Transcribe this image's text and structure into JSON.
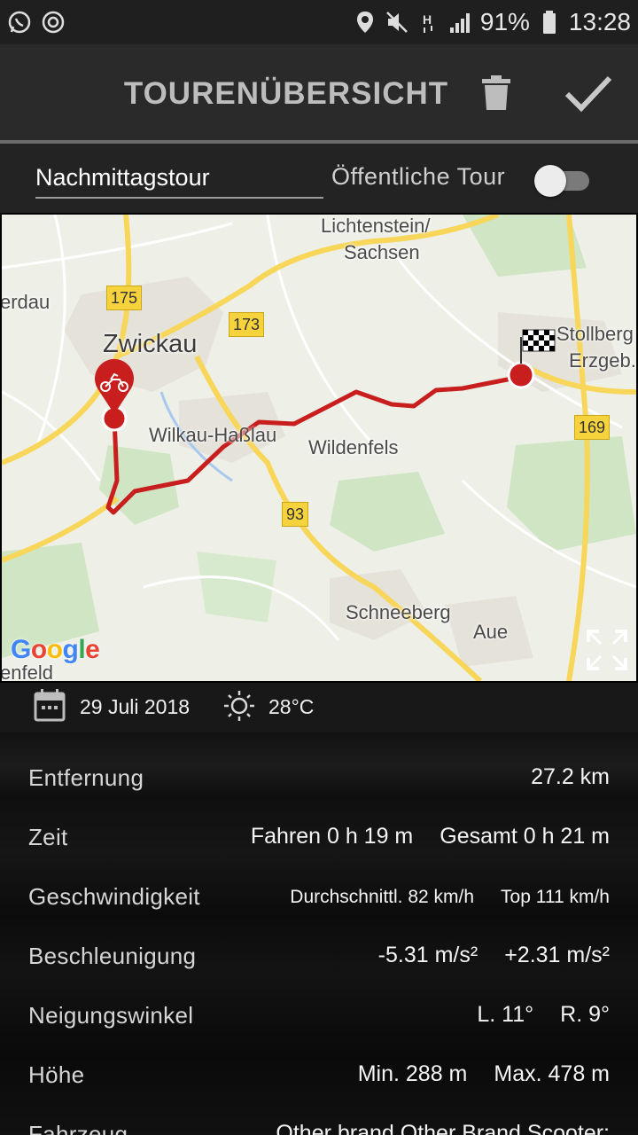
{
  "status_bar": {
    "battery": "91%",
    "time": "13:28"
  },
  "header": {
    "title": "TOURENÜBERSICHT"
  },
  "tour": {
    "name": "Nachmittagstour",
    "public_label": "Öffentliche Tour",
    "public_enabled": false
  },
  "map": {
    "labels": {
      "lichtenstein": "Lichtenstein/",
      "sachsen": "Sachsen",
      "erdau": "erdau",
      "zwickau": "Zwickau",
      "stollberg": "Stollberg",
      "erzgeb": "Erzgeb.",
      "wilkau": "Wilkau-Haßlau",
      "wildenfels": "Wildenfels",
      "schneeberg": "Schneeberg",
      "aue": "Aue",
      "enfeld": "enfeld"
    },
    "roads": {
      "r175": "175",
      "r173": "173",
      "r169": "169",
      "r93": "93"
    },
    "logo": "Google"
  },
  "info": {
    "date": "29 Juli 2018",
    "temperature": "28°C"
  },
  "stats": {
    "distance": {
      "label": "Entfernung",
      "value": "27.2 km"
    },
    "time": {
      "label": "Zeit",
      "driving": "Fahren 0 h 19 m",
      "total": "Gesamt 0 h 21 m"
    },
    "speed": {
      "label": "Geschwindigkeit",
      "avg": "Durchschnittl. 82 km/h",
      "top": "Top 111 km/h"
    },
    "acceleration": {
      "label": "Beschleunigung",
      "min": "-5.31 m/s²",
      "max": "+2.31 m/s²"
    },
    "lean": {
      "label": "Neigungswinkel",
      "left": "L. 11°",
      "right": "R. 9°"
    },
    "altitude": {
      "label": "Höhe",
      "min": "Min. 288 m",
      "max": "Max. 478 m"
    },
    "vehicle": {
      "label": "Fahrzeug",
      "value": "Other brand Other Brand Scooter;"
    }
  }
}
